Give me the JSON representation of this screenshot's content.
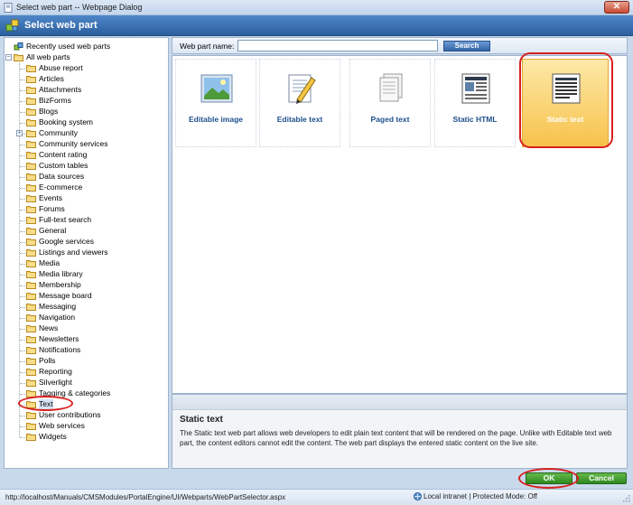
{
  "window": {
    "title": "Select web part -- Webpage Dialog",
    "close_label": "✕"
  },
  "header": {
    "title": "Select web part"
  },
  "tree": {
    "recent_label": "Recently used web parts",
    "root_label": "All web parts",
    "items": [
      "Abuse report",
      "Articles",
      "Attachments",
      "BizForms",
      "Blogs",
      "Booking system",
      "Community",
      "Community services",
      "Content rating",
      "Custom tables",
      "Data sources",
      "E-commerce",
      "Events",
      "Forums",
      "Full-text search",
      "General",
      "Google services",
      "Listings and viewers",
      "Media",
      "Media library",
      "Membership",
      "Message board",
      "Messaging",
      "Navigation",
      "News",
      "Newsletters",
      "Notifications",
      "Polls",
      "Reporting",
      "Silverlight",
      "Tagging & categories",
      "Text",
      "User contributions",
      "Web services",
      "Widgets"
    ],
    "expandable_item": "Community",
    "selected_item": "Text"
  },
  "search": {
    "label": "Web part name:",
    "value": "",
    "button_label": "Search"
  },
  "webparts": [
    {
      "label": "Editable image",
      "icon": "editable-image-icon",
      "selected": false
    },
    {
      "label": "Editable text",
      "icon": "editable-text-icon",
      "selected": false
    },
    {
      "label": "Paged text",
      "icon": "paged-text-icon",
      "selected": false
    },
    {
      "label": "Static HTML",
      "icon": "static-html-icon",
      "selected": false
    },
    {
      "label": "Static text",
      "icon": "static-text-icon",
      "selected": true
    }
  ],
  "description": {
    "title": "Static text",
    "text": "The Static text web part allows web developers to edit plain text content that will be rendered on the page. Unlike with Editable text web part, the content editors cannot edit the content. The web part displays the entered static content on the live site."
  },
  "buttons": {
    "ok": "OK",
    "cancel": "Cancel"
  },
  "status": {
    "url": "http://localhost/Manuals/CMSModules/PortalEngine/UI/Webparts/WebPartSelector.aspx",
    "zone": "Local intranet | Protected Mode: Off"
  },
  "colors": {
    "header": "#2c5f9e",
    "selected_tile": "#f7c24c",
    "highlight_ring": "#d8201e",
    "ok_button": "#2f8a1f"
  }
}
